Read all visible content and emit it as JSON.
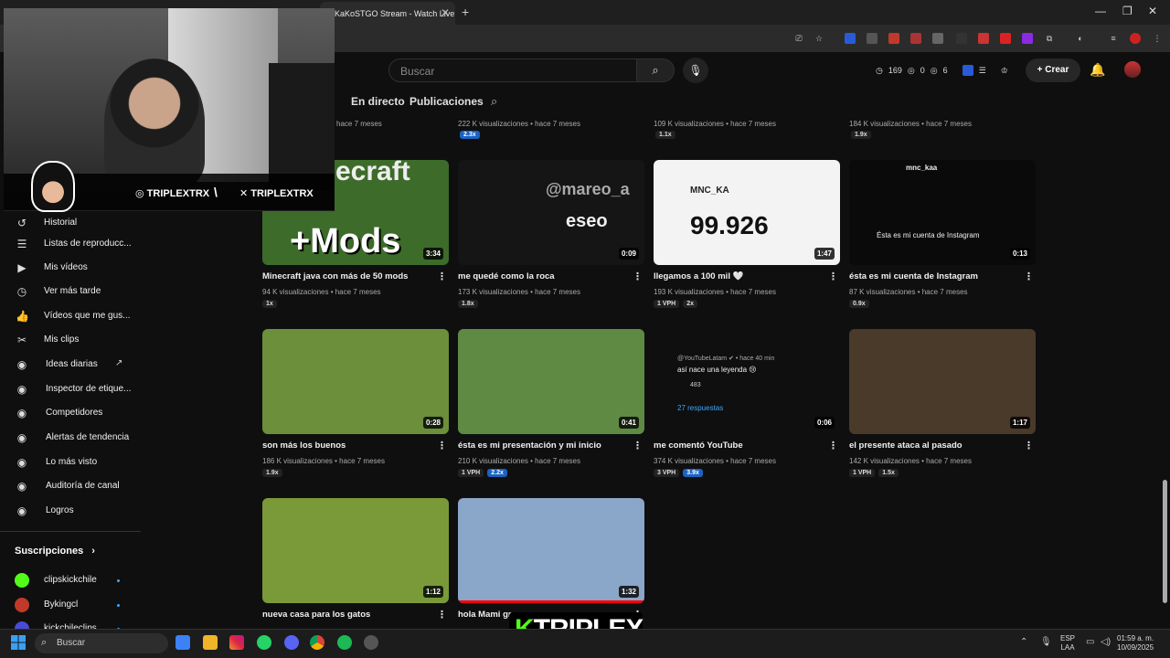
{
  "browser": {
    "tab_title": "KaKoSTGO Stream - Watch Live",
    "tab_close": "✕",
    "new_tab": "+",
    "window_controls": [
      "—",
      "❐",
      "✕"
    ]
  },
  "header": {
    "search_placeholder": "Buscar",
    "stats": {
      "views": "169",
      "likes": "0",
      "comments": "6"
    },
    "create_label": "Crear"
  },
  "channel_tabs": [
    "En directo",
    "Publicaciones"
  ],
  "sidebar": {
    "items": [
      {
        "label": "Historial",
        "icon": "history-icon",
        "glyph": "↺"
      },
      {
        "label": "Listas de reproducc...",
        "icon": "playlists-icon",
        "glyph": "☰"
      },
      {
        "label": "Mis vídeos",
        "icon": "my-videos-icon",
        "glyph": "▶"
      },
      {
        "label": "Ver más tarde",
        "icon": "watch-later-icon",
        "glyph": "◷"
      },
      {
        "label": "Vídeos que me gus...",
        "icon": "liked-videos-icon",
        "glyph": "👍"
      },
      {
        "label": "Mis clips",
        "icon": "clips-icon",
        "glyph": "✂"
      },
      {
        "label": "Ideas diarias",
        "icon": "ideas-icon",
        "glyph": "◉"
      },
      {
        "label": "Inspector de etique...",
        "icon": "tag-inspector-icon",
        "glyph": "◉"
      },
      {
        "label": "Competidores",
        "icon": "competitors-icon",
        "glyph": "◉"
      },
      {
        "label": "Alertas de tendencia",
        "icon": "trend-alerts-icon",
        "glyph": "◉"
      },
      {
        "label": "Lo más visto",
        "icon": "most-viewed-icon",
        "glyph": "◉"
      },
      {
        "label": "Auditoría de canal",
        "icon": "channel-audit-icon",
        "glyph": "◉"
      },
      {
        "label": "Logros",
        "icon": "achievements-icon",
        "glyph": "◉"
      }
    ],
    "subscriptions_title": "Suscripciones",
    "subscriptions_chevron": "›",
    "subscriptions": [
      {
        "name": "clipskickchile",
        "color": "#53fc18"
      },
      {
        "name": "Bykingcl",
        "color": "#c0392b"
      },
      {
        "name": "kickchileclips",
        "color": "#4a4ad8"
      }
    ]
  },
  "top_row_meta": [
    {
      "meta": "222 K visualizaciones • hace 7 meses",
      "badges": [
        {
          "text": "2.3x",
          "blue": true
        }
      ]
    },
    {
      "meta": "109 K visualizaciones • hace 7 meses",
      "badges": [
        {
          "text": "1.1x",
          "blue": false
        }
      ]
    },
    {
      "meta": "184 K visualizaciones • hace 7 meses",
      "badges": [
        {
          "text": "1.9x",
          "blue": false
        }
      ]
    },
    {
      "meta": "hace 7 meses"
    }
  ],
  "videos": [
    {
      "title": "Minecraft java con más de 50 mods",
      "duration": "3:34",
      "meta": "94 K visualizaciones • hace 7 meses",
      "badges": [
        {
          "text": "1x",
          "blue": false
        }
      ],
      "thumb_text": "+Mods",
      "thumb_text2": "ecraft",
      "thumb_bg": "#3d6b2a"
    },
    {
      "title": "me quedé como la roca",
      "duration": "0:09",
      "meta": "173 K visualizaciones • hace 7 meses",
      "badges": [
        {
          "text": "1.8x",
          "blue": false
        }
      ],
      "thumb_text": "eseo",
      "thumb_text2": "@mareo_a",
      "thumb_bg": "#151515"
    },
    {
      "title": "llegamos a 100 mil 🤍",
      "duration": "1:47",
      "meta": "193 K visualizaciones • hace 7 meses",
      "badges": [
        {
          "text": "1 VPH",
          "blue": false
        },
        {
          "text": "2x",
          "blue": false
        }
      ],
      "thumb_text": "99.926",
      "thumb_text2": "MNC_KA",
      "thumb_bg": "#f3f3f3"
    },
    {
      "title": "ésta es mi cuenta de Instagram",
      "duration": "0:13",
      "meta": "87 K visualizaciones • hace 7 meses",
      "badges": [
        {
          "text": "0.9x",
          "blue": false
        }
      ],
      "thumb_text": "Ésta es mi cuenta de Instagram",
      "thumb_text2": "mnc_kaa",
      "thumb_bg": "#0a0a0a"
    },
    {
      "title": "son más los buenos",
      "duration": "0:28",
      "meta": "186 K visualizaciones • hace 7 meses",
      "badges": [
        {
          "text": "1.9x",
          "blue": false
        }
      ],
      "thumb_text": "",
      "thumb_text2": "",
      "thumb_bg": "#6b8f3a"
    },
    {
      "title": "ésta es mi presentación y mi inicio",
      "duration": "0:41",
      "meta": "210 K visualizaciones • hace 7 meses",
      "badges": [
        {
          "text": "1 VPH",
          "blue": false
        },
        {
          "text": "2.2x",
          "blue": true
        }
      ],
      "thumb_text": "",
      "thumb_text2": "",
      "thumb_bg": "#5f8a44"
    },
    {
      "title": "me comentó YouTube",
      "duration": "0:06",
      "meta": "374 K visualizaciones • hace 7 meses",
      "badges": [
        {
          "text": "3 VPH",
          "blue": false
        },
        {
          "text": "3.9x",
          "blue": true
        }
      ],
      "thumb_text": "así nace una leyenda 😢",
      "thumb_text2": "@YouTubeLatam ✔ • hace 40 min",
      "thumb_extra": "27 respuestas",
      "thumb_likes": "483",
      "thumb_bg": "#0f0f0f"
    },
    {
      "title": "el presente ataca al pasado",
      "duration": "1:17",
      "meta": "142 K visualizaciones • hace 7 meses",
      "badges": [
        {
          "text": "1 VPH",
          "blue": false
        },
        {
          "text": "1.5x",
          "blue": false
        }
      ],
      "thumb_text": "",
      "thumb_text2": "",
      "thumb_bg": "#4a3a2a"
    },
    {
      "title": "nueva casa para los gatos",
      "duration": "1:12",
      "meta": "",
      "badges": [],
      "thumb_text": "",
      "thumb_text2": "",
      "thumb_bg": "#7a9a3a"
    },
    {
      "title": "hola Mami gr... una casa gra...",
      "duration": "1:32",
      "meta": "",
      "badges": [],
      "thumb_text": "",
      "thumb_text2": "",
      "thumb_bg": "#8aa6c8"
    }
  ],
  "overlay": {
    "instagram_handle": "TRIPLEXTRX",
    "x_handle": "TRIPLEXTRX",
    "separator": "\\",
    "brand_k": "K",
    "brand_rest": "TRIPLEX"
  },
  "taskbar": {
    "search_placeholder": "Buscar",
    "lang_top": "ESP",
    "lang_bottom": "LAA",
    "time": "01:59 a. m.",
    "date": "10/09/2025"
  }
}
